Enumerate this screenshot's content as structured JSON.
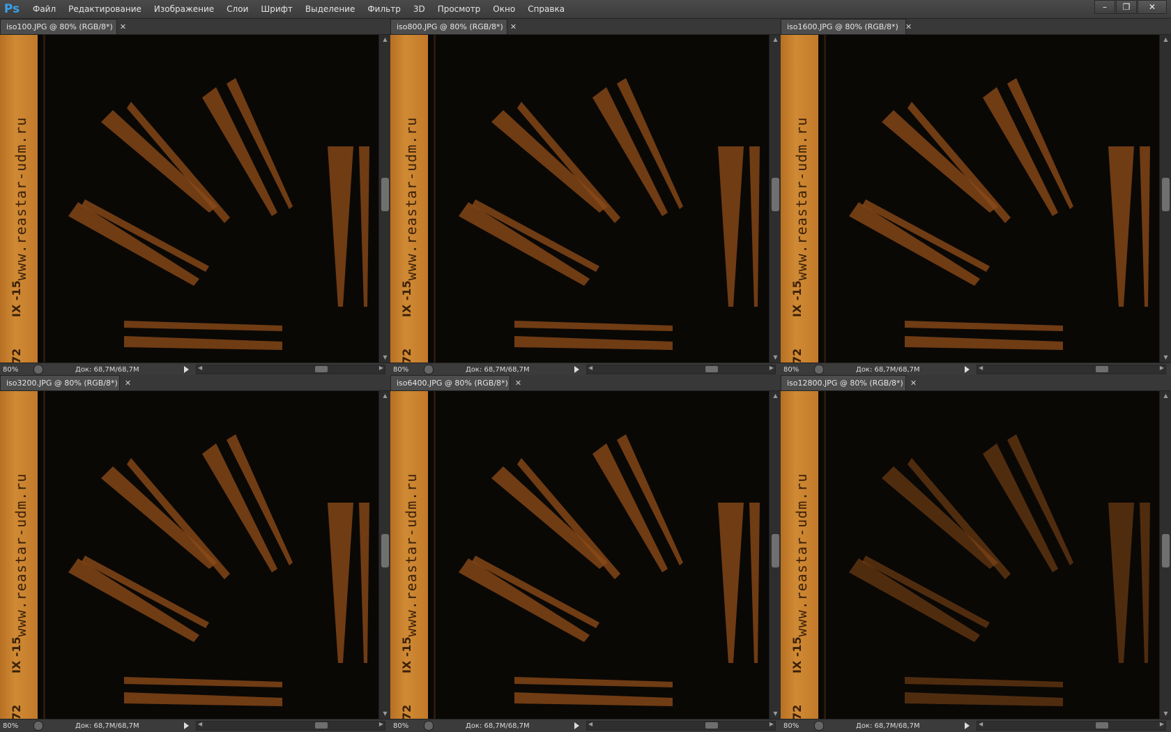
{
  "app": {
    "logo": "Ps",
    "menu": [
      "Файл",
      "Редактирование",
      "Изображение",
      "Слои",
      "Шрифт",
      "Выделение",
      "Фильтр",
      "3D",
      "Просмотр",
      "Окно",
      "Справка"
    ],
    "window_controls": [
      "minimize-icon",
      "restore-icon",
      "close-icon"
    ]
  },
  "panels": [
    {
      "tab": "iso100.JPG @ 80% (RGB/8*)",
      "zoom": "80%",
      "doc": "Док: 68,7M/68,7M"
    },
    {
      "tab": "iso800.JPG @ 80% (RGB/8*)",
      "zoom": "80%",
      "doc": "Док: 68,7M/68,7M"
    },
    {
      "tab": "iso1600.JPG @ 80% (RGB/8*)",
      "zoom": "80%",
      "doc": "Док: 68,7M/68,7M"
    },
    {
      "tab": "iso3200.JPG @ 80% (RGB/8*)",
      "zoom": "80%",
      "doc": "Док: 68,7M/68,7M"
    },
    {
      "tab": "iso6400.JPG @ 80% (RGB/8*)",
      "zoom": "80%",
      "doc": "Док: 68,7M/68,7M"
    },
    {
      "tab": "iso12800.JPG @ 80% (RGB/8*)",
      "zoom": "80%",
      "doc": "Док: 68,7M/68,7M"
    }
  ],
  "image": {
    "ruler_text": "www.reastar-udm.ru",
    "ruler_mark_1": "IX -15",
    "ruler_mark_2": "72",
    "stroke_color": "#8a4a18"
  }
}
